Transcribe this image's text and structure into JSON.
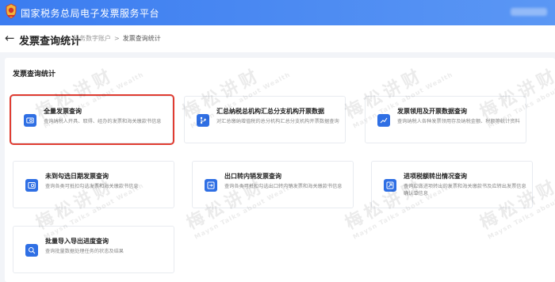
{
  "app": {
    "title": "国家税务总局电子发票服务平台"
  },
  "header": {
    "back_icon": "arrow-left-icon",
    "page_title": "发票查询统计",
    "breadcrumb": [
      "税务数字账户",
      "发票查询统计"
    ],
    "separator": ">"
  },
  "section": {
    "title": "发票查询统计"
  },
  "cards": [
    {
      "title": "全量发票查询",
      "desc": "查询纳税人开具、取得、经办的发票和海关缴款书信息",
      "icon": "invoice-search-icon",
      "selected": true
    },
    {
      "title": "汇总纳税总机构汇总分支机构开票数据",
      "desc": "对汇总缴纳增值税的总分机构汇总分支机构开票数据查询",
      "icon": "branch-tree-icon"
    },
    {
      "title": "发票领用及开票数据查询",
      "desc": "查询纳税人各种发票领用存及纳税金额、税额等统计资料",
      "icon": "chart-line-icon"
    },
    {
      "title": "未到勾选日期发票查询",
      "desc": "查询各类可抵扣勾选发票和海关缴款书信息",
      "icon": "clock-check-icon"
    },
    {
      "title": "出口转内销发票查询",
      "desc": "查询各类可抵扣勾选出口转内销发票和海关缴款书信息",
      "icon": "export-transfer-icon"
    },
    {
      "title": "进项税额转出情况查询",
      "desc": "查询应做进项转出的发票和海关缴款书及应转出发票信息确认单信息",
      "icon": "tax-transfer-icon"
    },
    {
      "title": "批量导入导出进度查询",
      "desc": "查询批量数据处理任务的状态及结果",
      "icon": "progress-search-icon"
    }
  ],
  "watermark": {
    "text": "梅松讲财",
    "subtext": "Maysn Talks about Wealth"
  },
  "colors": {
    "topbar": "#3b7cf0",
    "accent": "#2f6fe4",
    "highlight": "#e03c31"
  }
}
